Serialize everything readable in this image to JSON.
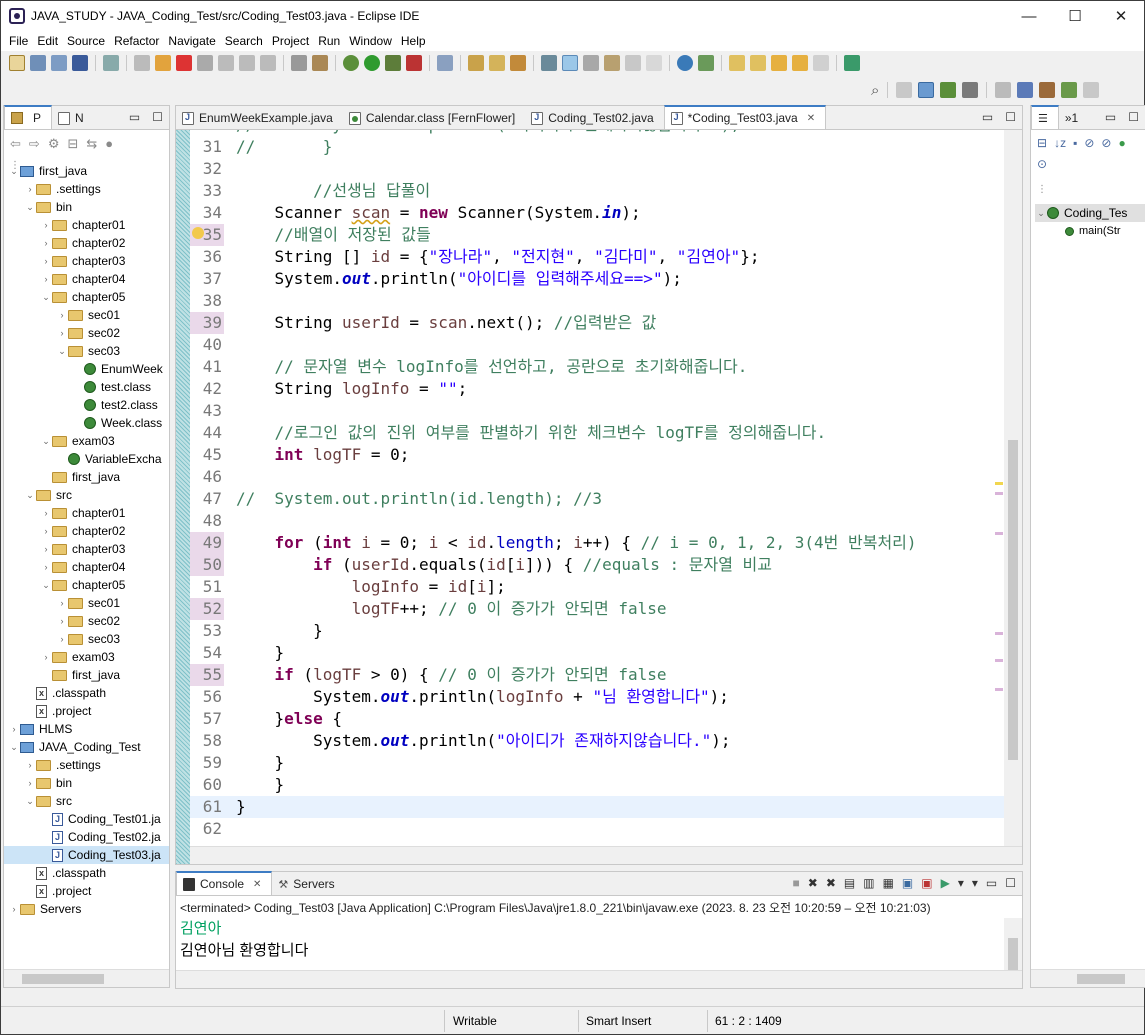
{
  "window": {
    "title": "JAVA_STUDY - JAVA_Coding_Test/src/Coding_Test03.java - Eclipse IDE",
    "controls": [
      "—",
      "☐",
      "✕"
    ]
  },
  "menu": [
    "File",
    "Edit",
    "Source",
    "Refactor",
    "Navigate",
    "Search",
    "Project",
    "Run",
    "Window",
    "Help"
  ],
  "left_panel": {
    "tabs": [
      "P",
      "N"
    ],
    "tree": [
      {
        "label": "first_java",
        "depth": 0,
        "arrow": "open",
        "icon": "proj"
      },
      {
        "label": ".settings",
        "depth": 1,
        "arrow": "closed",
        "icon": "folder"
      },
      {
        "label": "bin",
        "depth": 1,
        "arrow": "open",
        "icon": "folder"
      },
      {
        "label": "chapter01",
        "depth": 2,
        "arrow": "closed",
        "icon": "folder"
      },
      {
        "label": "chapter02",
        "depth": 2,
        "arrow": "closed",
        "icon": "folder"
      },
      {
        "label": "chapter03",
        "depth": 2,
        "arrow": "closed",
        "icon": "folder"
      },
      {
        "label": "chapter04",
        "depth": 2,
        "arrow": "closed",
        "icon": "folder"
      },
      {
        "label": "chapter05",
        "depth": 2,
        "arrow": "open",
        "icon": "folder"
      },
      {
        "label": "sec01",
        "depth": 3,
        "arrow": "closed",
        "icon": "folder"
      },
      {
        "label": "sec02",
        "depth": 3,
        "arrow": "closed",
        "icon": "folder"
      },
      {
        "label": "sec03",
        "depth": 3,
        "arrow": "open",
        "icon": "folder"
      },
      {
        "label": "EnumWeek",
        "depth": 4,
        "arrow": "",
        "icon": "cls"
      },
      {
        "label": "test.class",
        "depth": 4,
        "arrow": "",
        "icon": "cls"
      },
      {
        "label": "test2.class",
        "depth": 4,
        "arrow": "",
        "icon": "cls"
      },
      {
        "label": "Week.class",
        "depth": 4,
        "arrow": "",
        "icon": "cls"
      },
      {
        "label": "exam03",
        "depth": 2,
        "arrow": "open",
        "icon": "folder"
      },
      {
        "label": "VariableExcha",
        "depth": 3,
        "arrow": "",
        "icon": "cls"
      },
      {
        "label": "first_java",
        "depth": 2,
        "arrow": "",
        "icon": "folder"
      },
      {
        "label": "src",
        "depth": 1,
        "arrow": "open",
        "icon": "folder"
      },
      {
        "label": "chapter01",
        "depth": 2,
        "arrow": "closed",
        "icon": "folder"
      },
      {
        "label": "chapter02",
        "depth": 2,
        "arrow": "closed",
        "icon": "folder"
      },
      {
        "label": "chapter03",
        "depth": 2,
        "arrow": "closed",
        "icon": "folder"
      },
      {
        "label": "chapter04",
        "depth": 2,
        "arrow": "closed",
        "icon": "folder"
      },
      {
        "label": "chapter05",
        "depth": 2,
        "arrow": "open",
        "icon": "folder"
      },
      {
        "label": "sec01",
        "depth": 3,
        "arrow": "closed",
        "icon": "folder"
      },
      {
        "label": "sec02",
        "depth": 3,
        "arrow": "closed",
        "icon": "folder"
      },
      {
        "label": "sec03",
        "depth": 3,
        "arrow": "closed",
        "icon": "folder"
      },
      {
        "label": "exam03",
        "depth": 2,
        "arrow": "closed",
        "icon": "folder"
      },
      {
        "label": "first_java",
        "depth": 2,
        "arrow": "",
        "icon": "folder"
      },
      {
        "label": ".classpath",
        "depth": 1,
        "arrow": "",
        "icon": "xfile"
      },
      {
        "label": ".project",
        "depth": 1,
        "arrow": "",
        "icon": "xfile"
      },
      {
        "label": "HLMS",
        "depth": 0,
        "arrow": "closed",
        "icon": "proj"
      },
      {
        "label": "JAVA_Coding_Test",
        "depth": 0,
        "arrow": "open",
        "icon": "proj"
      },
      {
        "label": ".settings",
        "depth": 1,
        "arrow": "closed",
        "icon": "folder"
      },
      {
        "label": "bin",
        "depth": 1,
        "arrow": "closed",
        "icon": "folder"
      },
      {
        "label": "src",
        "depth": 1,
        "arrow": "open",
        "icon": "folder"
      },
      {
        "label": "Coding_Test01.ja",
        "depth": 2,
        "arrow": "",
        "icon": "jfile"
      },
      {
        "label": "Coding_Test02.ja",
        "depth": 2,
        "arrow": "",
        "icon": "jfile"
      },
      {
        "label": "Coding_Test03.ja",
        "depth": 2,
        "arrow": "",
        "icon": "jfile",
        "selected": true
      },
      {
        "label": ".classpath",
        "depth": 1,
        "arrow": "",
        "icon": "xfile"
      },
      {
        "label": ".project",
        "depth": 1,
        "arrow": "",
        "icon": "xfile"
      },
      {
        "label": "Servers",
        "depth": 0,
        "arrow": "closed",
        "icon": "folder"
      }
    ]
  },
  "editor": {
    "tabs": [
      {
        "label": "EnumWeekExample.java",
        "icon": "j",
        "active": false
      },
      {
        "label": "Calendar.class [FernFlower]",
        "icon": "c",
        "active": false
      },
      {
        "label": "Coding_Test02.java",
        "icon": "j",
        "active": false
      },
      {
        "label": "*Coding_Test03.java",
        "icon": "j",
        "active": true
      }
    ],
    "lines": [
      {
        "n": "31",
        "chg": false,
        "html": "<span class=\"cm\">//       }</span>"
      },
      {
        "n": "32",
        "chg": false,
        "html": ""
      },
      {
        "n": "33",
        "chg": false,
        "html": "        <span class=\"cm\">//선생님 답풀이</span>"
      },
      {
        "n": "34",
        "chg": false,
        "html": "    Scanner <span class=\"loc\" style=\"text-decoration:underline wavy #d4a017\">scan</span> = <span class=\"kw\">new</span> Scanner(System.<span class=\"fld\">in</span>);"
      },
      {
        "n": "35",
        "chg": true,
        "html": "    <span class=\"cm\">//배열이 저장된 값들</span>"
      },
      {
        "n": "36",
        "chg": false,
        "html": "    String [] <span class=\"loc\">id</span> = {<span class=\"st\">\"장나라\"</span>, <span class=\"st\">\"전지현\"</span>, <span class=\"st\">\"김다미\"</span>, <span class=\"st\">\"김연아\"</span>};"
      },
      {
        "n": "37",
        "chg": false,
        "html": "    System.<span class=\"fld\">out</span>.println(<span class=\"st\">\"아이디를 입력해주세요==>\"</span>);"
      },
      {
        "n": "38",
        "chg": false,
        "html": ""
      },
      {
        "n": "39",
        "chg": true,
        "html": "    String <span class=\"loc\">userId</span> = <span class=\"loc\">scan</span>.next(); <span class=\"cm\">//입력받은 값</span>"
      },
      {
        "n": "40",
        "chg": false,
        "html": ""
      },
      {
        "n": "41",
        "chg": false,
        "html": "    <span class=\"cm\">// 문자열 변수 logInfo를 선언하고, 공란으로 초기화해줍니다.</span>"
      },
      {
        "n": "42",
        "chg": false,
        "html": "    String <span class=\"loc\">logInfo</span> = <span class=\"st\">\"\"</span>;"
      },
      {
        "n": "43",
        "chg": false,
        "html": ""
      },
      {
        "n": "44",
        "chg": false,
        "html": "    <span class=\"cm\">//로그인 값의 진위 여부를 판별하기 위한 체크변수 logTF를 정의해줍니다.</span>"
      },
      {
        "n": "45",
        "chg": false,
        "html": "    <span class=\"kw\">int</span> <span class=\"loc\">logTF</span> = 0;"
      },
      {
        "n": "46",
        "chg": false,
        "html": ""
      },
      {
        "n": "47",
        "chg": false,
        "html": "<span class=\"cm\">//  System.out.println(id.length); //3</span>"
      },
      {
        "n": "48",
        "chg": false,
        "html": ""
      },
      {
        "n": "49",
        "chg": true,
        "html": "    <span class=\"kw\">for</span> (<span class=\"kw\">int</span> <span class=\"loc\">i</span> = 0; <span class=\"loc\">i</span> &lt; <span class=\"loc\">id</span>.<span class=\"fld\" style=\"font-style:normal;font-weight:normal\">length</span>; <span class=\"loc\">i</span>++) { <span class=\"cm\">// i = 0, 1, 2, 3(4번 반복처리)</span>"
      },
      {
        "n": "50",
        "chg": true,
        "html": "        <span class=\"kw\">if</span> (<span class=\"loc\">userId</span>.equals(<span class=\"loc\">id</span>[<span class=\"loc\">i</span>])) { <span class=\"cm\">//equals : 문자열 비교</span>"
      },
      {
        "n": "51",
        "chg": false,
        "html": "            <span class=\"loc\">logInfo</span> = <span class=\"loc\">id</span>[<span class=\"loc\">i</span>];"
      },
      {
        "n": "52",
        "chg": true,
        "html": "            <span class=\"loc\">logTF</span>++; <span class=\"cm\">// 0 이 증가가 안되면 false</span>"
      },
      {
        "n": "53",
        "chg": false,
        "html": "        }"
      },
      {
        "n": "54",
        "chg": false,
        "html": "    }"
      },
      {
        "n": "55",
        "chg": true,
        "html": "    <span class=\"kw\">if</span> (<span class=\"loc\">logTF</span> &gt; 0) { <span class=\"cm\">// 0 이 증가가 안되면 false</span>"
      },
      {
        "n": "56",
        "chg": false,
        "html": "        System.<span class=\"fld\">out</span>.println(<span class=\"loc\">logInfo</span> + <span class=\"st\">\"님 환영합니다\"</span>);"
      },
      {
        "n": "57",
        "chg": false,
        "html": "    }<span class=\"kw\">else</span> {"
      },
      {
        "n": "58",
        "chg": false,
        "html": "        System.<span class=\"fld\">out</span>.println(<span class=\"st\">\"아이디가 존재하지않습니다.\"</span>);"
      },
      {
        "n": "59",
        "chg": false,
        "html": "    }"
      },
      {
        "n": "60",
        "chg": false,
        "html": "    }"
      },
      {
        "n": "61",
        "chg": false,
        "html": "}",
        "cur": true
      },
      {
        "n": "62",
        "chg": false,
        "html": ""
      }
    ]
  },
  "console": {
    "tabs": [
      "Console",
      "Servers"
    ],
    "meta": "<terminated> Coding_Test03 [Java Application] C:\\Program Files\\Java\\jre1.8.0_221\\bin\\javaw.exe  (2023. 8. 23 오전 10:20:59 – 오전 10:21:03)",
    "input_line": "김연아",
    "output_line": "김연아님 환영합니다"
  },
  "outline": {
    "tabs": [
      "»1"
    ],
    "class_label": "Coding_Tes",
    "method_label": "main(Str"
  },
  "status": {
    "mode": "Writable",
    "insert": "Smart Insert",
    "position": "61 : 2 : 1409"
  }
}
